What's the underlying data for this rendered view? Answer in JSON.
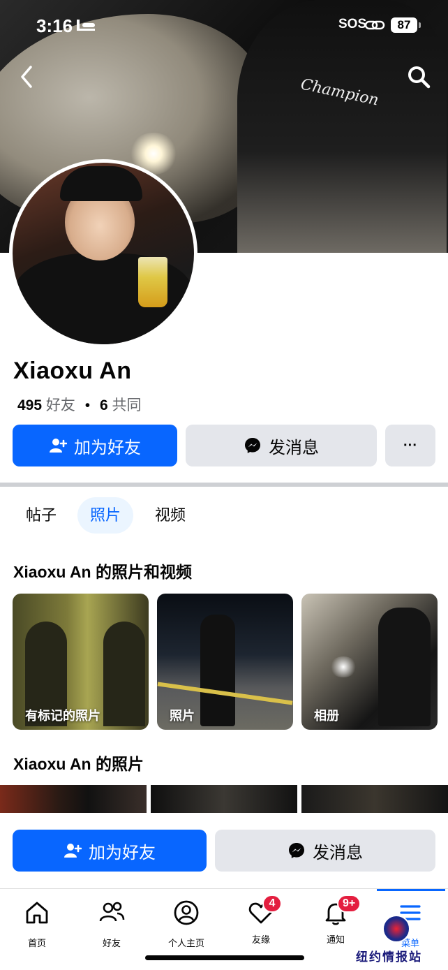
{
  "status_bar": {
    "time": "3:16",
    "sos": "SOS",
    "battery": "87"
  },
  "profile": {
    "name": "Xiaoxu  An",
    "friends_count": "495",
    "friends_label": "好友",
    "separator": "•",
    "mutual_count": "6",
    "mutual_label": "共同"
  },
  "actions": {
    "add_friend": "加为好友",
    "message": "发消息",
    "more": "···"
  },
  "tabs": [
    {
      "label": "帖子"
    },
    {
      "label": "照片"
    },
    {
      "label": "视频"
    }
  ],
  "sections": {
    "photos_and_videos_title": "Xiaoxu  An 的照片和视频",
    "photos_title": "Xiaoxu  An 的照片"
  },
  "albums": [
    {
      "label": "有标记的照片"
    },
    {
      "label": "照片"
    },
    {
      "label": "相册"
    }
  ],
  "sticky_actions": {
    "add_friend": "加为好友",
    "message": "发消息"
  },
  "cover": {
    "shirt_text": "Champion"
  },
  "nav": [
    {
      "label": "首页",
      "icon": "home-icon"
    },
    {
      "label": "好友",
      "icon": "friends-icon"
    },
    {
      "label": "个人主页",
      "icon": "profile-icon"
    },
    {
      "label": "友缘",
      "icon": "dating-heart-icon",
      "badge": "4"
    },
    {
      "label": "通知",
      "icon": "bell-icon",
      "badge": "9+"
    },
    {
      "label": "菜单",
      "icon": "menu-icon"
    }
  ],
  "watermark": {
    "text": "纽约情报站"
  },
  "colors": {
    "accent": "#0866ff",
    "badge": "#e41e3f",
    "secondary_button": "#e4e6eb"
  }
}
